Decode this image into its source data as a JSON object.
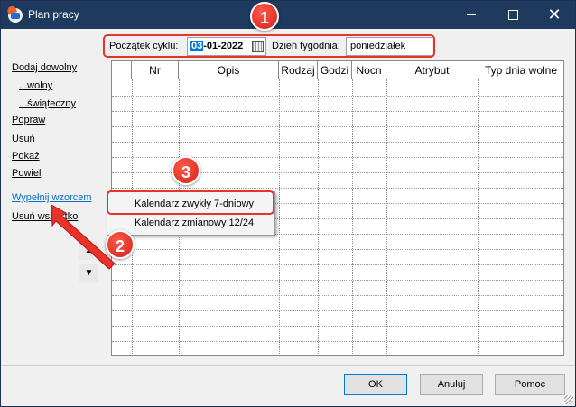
{
  "window": {
    "title": "Plan pracy",
    "controls": {
      "minimize": "—",
      "maximize": "☐",
      "close": "✕"
    }
  },
  "header": {
    "cycle_start_label": "Początek cyklu:",
    "cycle_start_selected": "03",
    "cycle_start_rest": "-01-2022",
    "weekday_label": "Dzień tygodnia:",
    "weekday_value": "poniedziałek"
  },
  "sidebar": {
    "items": [
      {
        "label": "Dodaj dowolny"
      },
      {
        "label": "...wolny"
      },
      {
        "label": "...świąteczny"
      },
      {
        "label": "Popraw"
      },
      {
        "label": "Usuń"
      },
      {
        "label": "Pokaż"
      },
      {
        "label": "Powiel"
      },
      {
        "label": "Wypełnij wzorcem"
      },
      {
        "label": "Usuń wszystko"
      }
    ],
    "arrow_up": "▲",
    "arrow_down": "▼"
  },
  "table": {
    "columns": [
      "",
      "Nr",
      "Opis",
      "Rodzaj",
      "Godzi",
      "Nocn",
      "Atrybut",
      "Typ dnia wolne"
    ]
  },
  "context_menu": {
    "items": [
      "Kalendarz zwykły 7-dniowy",
      "Kalendarz zmianowy 12/24"
    ]
  },
  "annotations": {
    "badges": [
      "1",
      "2",
      "3"
    ],
    "color": "#e8332a"
  },
  "footer": {
    "ok": "OK",
    "cancel": "Anuluj",
    "help": "Pomoc"
  }
}
